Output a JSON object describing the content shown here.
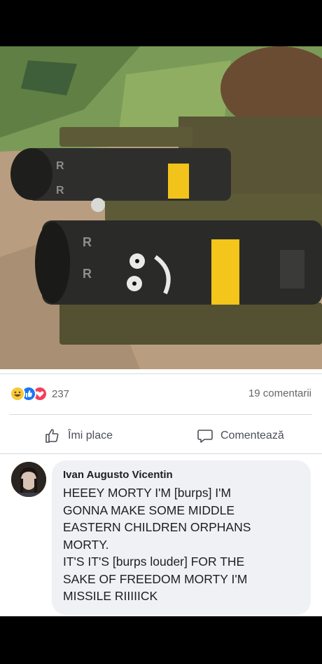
{
  "post": {
    "image_alt": "Missiles mounted on helicopter with a cartoon face drawn on one",
    "missile_markings": [
      "R",
      "R",
      "R",
      "R"
    ]
  },
  "reactions": {
    "icons": [
      "haha-icon",
      "like-icon",
      "love-icon"
    ],
    "count": "237",
    "comments_label": "19 comentarii"
  },
  "actions": {
    "like_label": "Îmi place",
    "comment_label": "Comentează"
  },
  "comment": {
    "author": "Ivan Augusto Vicentin",
    "text": "HEEEY MORTY I'M [burps] I'M\nGONNA MAKE SOME MIDDLE\nEASTERN CHILDREN ORPHANS\nMORTY.\nIT'S IT'S [burps louder] FOR THE\nSAKE OF FREEDOM MORTY I'M\nMISSILE RIIIIICK"
  },
  "colors": {
    "facebook_blue": "#1877f2",
    "text_secondary": "#65676b",
    "bubble_bg": "#eff1f4"
  }
}
